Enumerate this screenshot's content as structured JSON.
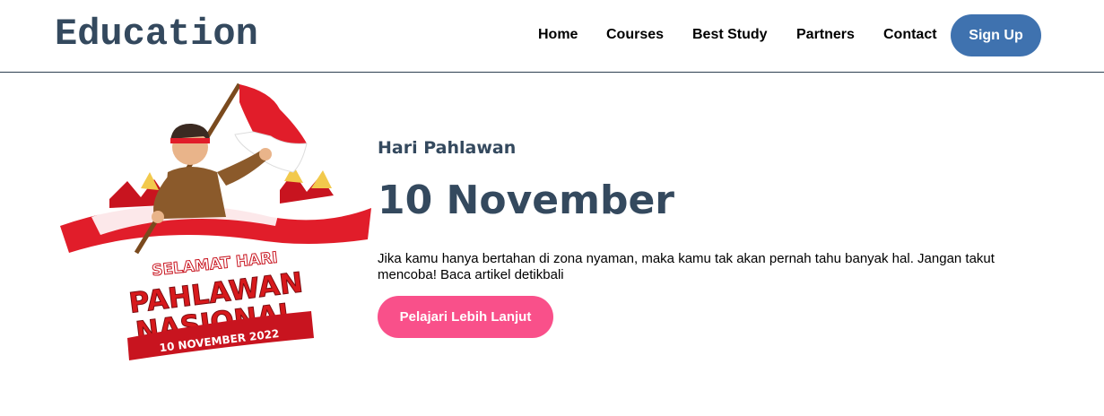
{
  "header": {
    "logo": "Education",
    "nav": [
      "Home",
      "Courses",
      "Best Study",
      "Partners",
      "Contact"
    ],
    "signup_label": "Sign Up"
  },
  "hero": {
    "image": {
      "banner_line1": "SELAMAT HARI",
      "banner_line2": "PAHLAWAN",
      "banner_line3": "NASIONAL",
      "banner_date": "10 NOVEMBER 2022"
    },
    "subtitle": "Hari Pahlawan",
    "title": "10 November",
    "description": "Jika kamu hanya bertahan di zona nyaman, maka kamu tak akan pernah tahu banyak hal. Jangan takut mencoba! Baca artikel detikbali",
    "cta_label": "Pelajari Lebih Lanjut"
  },
  "colors": {
    "brand": "#34495e",
    "signup": "#3f72af",
    "cta": "#f9508a",
    "flag_red": "#d7191c"
  }
}
